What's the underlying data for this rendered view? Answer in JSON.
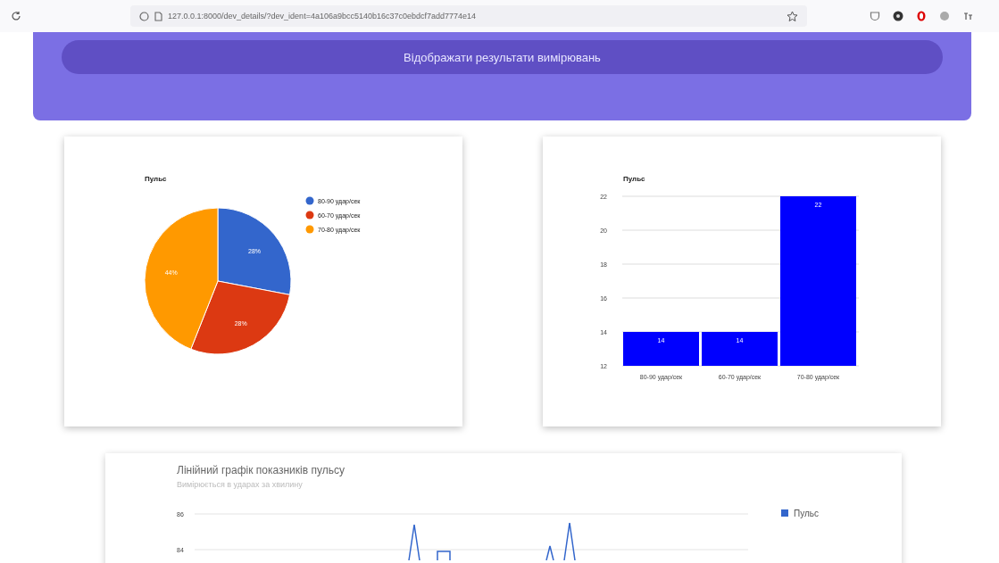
{
  "browser": {
    "url": "127.0.0.1:8000/dev_details/?dev_ident=4a106a9bcc5140b16c37c0ebdcf7add7774e14"
  },
  "header": {
    "button": "Відображати результати вимірювань"
  },
  "pie_card": {
    "chart_data": {
      "type": "pie",
      "title": "Пульс",
      "categories": [
        "80-90 удар/сек",
        "60-70 удар/сек",
        "70-80 удар/сек"
      ],
      "values": [
        28,
        28,
        44
      ],
      "legend": "right",
      "colors": [
        "#3366cc",
        "#dc3912",
        "#ff9900"
      ],
      "value_labels": [
        "28%",
        "28%",
        "44%"
      ]
    }
  },
  "bar_card": {
    "chart_data": {
      "type": "bar",
      "title": "Пульс",
      "categories": [
        "80-90 удар/сек",
        "60-70 удар/сек",
        "70-80 удар/сек"
      ],
      "series": [
        {
          "color": "#0000ff",
          "values": [
            14,
            14,
            22
          ]
        }
      ],
      "grid": true,
      "ylim": [
        12,
        22
      ],
      "yticks": [
        12,
        14,
        16,
        18,
        20,
        22
      ],
      "value_labels": [
        "14",
        "14",
        "22"
      ]
    }
  },
  "line_card": {
    "title": "Лінійний графік показників пульсу",
    "subtitle": "Вимірюється в ударах за хвилину",
    "tick_labels": [
      "86",
      "84"
    ],
    "legend": "Пульс",
    "color": "#3366cc"
  }
}
